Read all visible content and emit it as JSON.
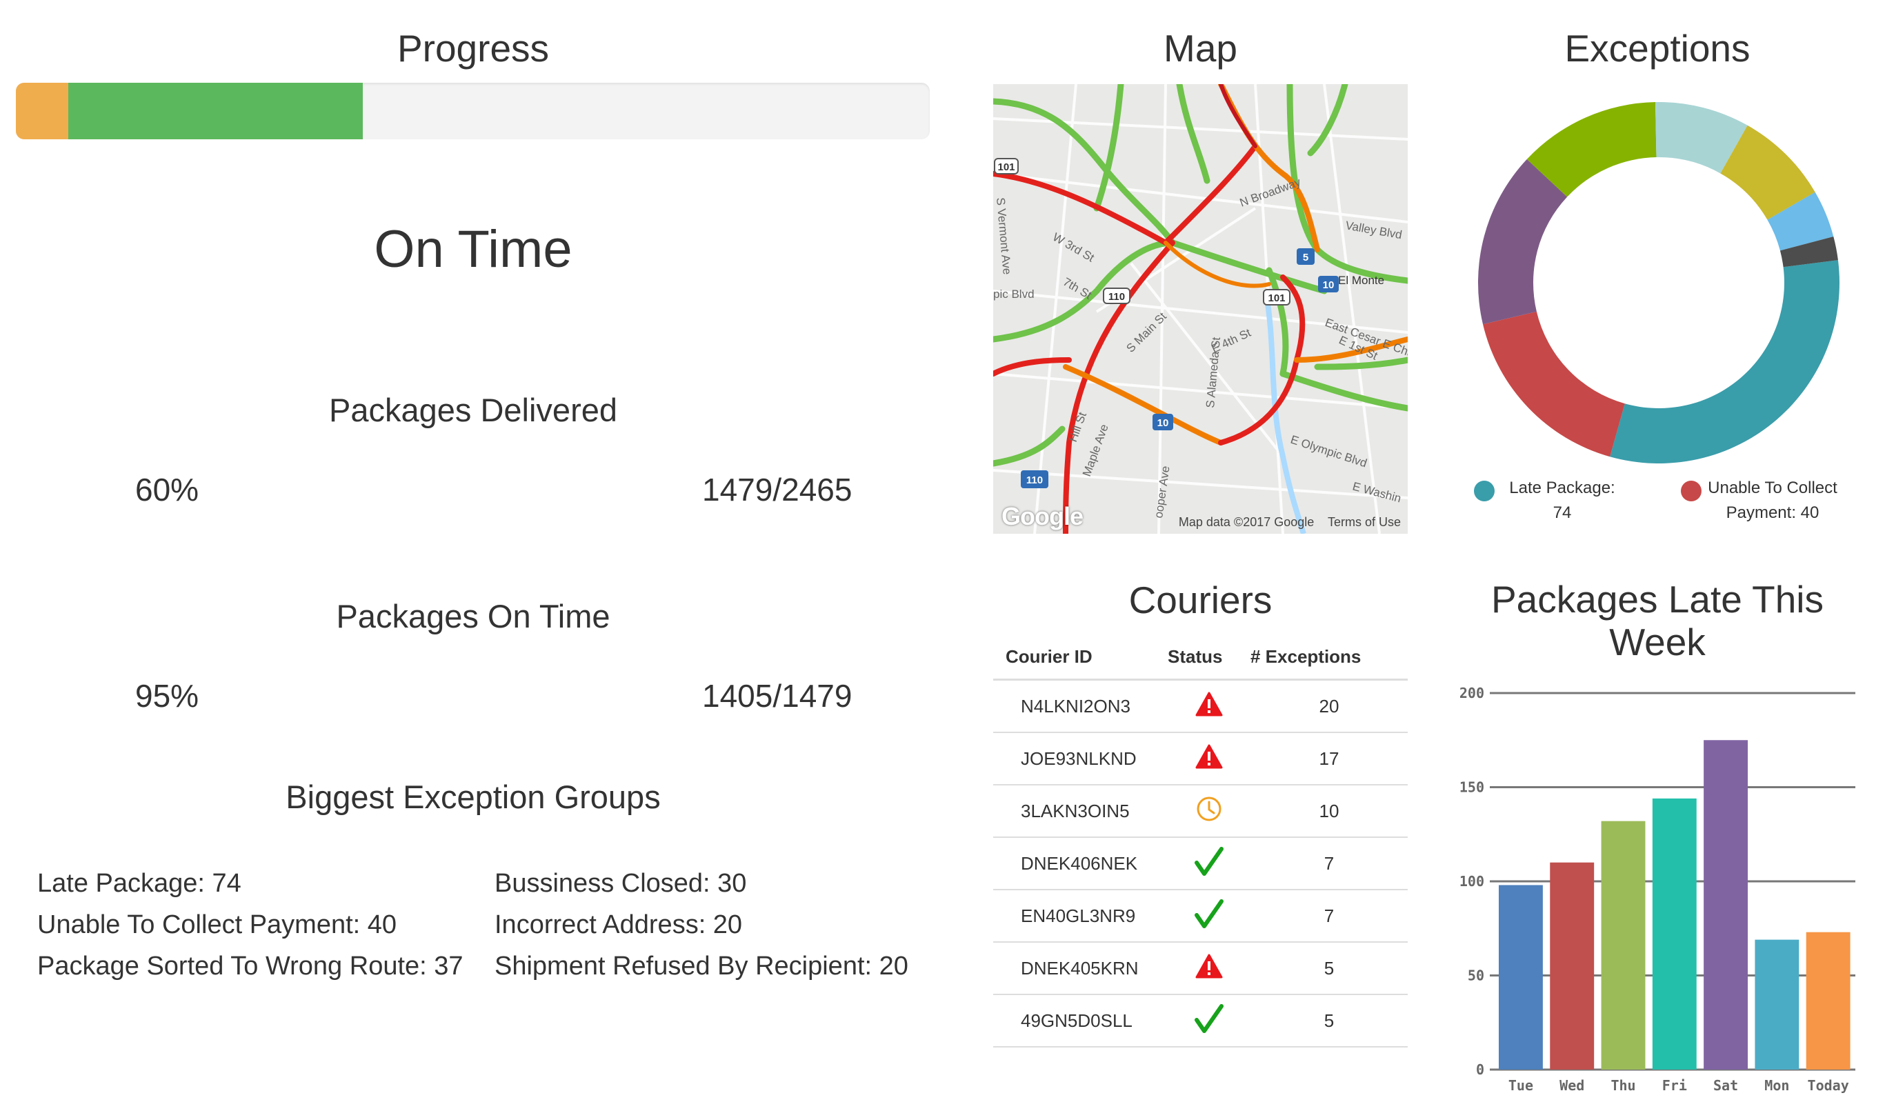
{
  "progress": {
    "title": "Progress",
    "segments": [
      {
        "name": "late",
        "color": "#f0ad4e",
        "percent": 5.7
      },
      {
        "name": "on-time",
        "color": "#5cb85c",
        "percent": 32.3
      }
    ],
    "status": "On Time"
  },
  "packages_delivered": {
    "title": "Packages Delivered",
    "percent": "60%",
    "count": "1479/2465"
  },
  "packages_on_time": {
    "title": "Packages On Time",
    "percent": "95%",
    "count": "1405/1479"
  },
  "exception_groups": {
    "title": "Biggest Exception Groups",
    "items": [
      "Late Package: 74",
      "Unable To Collect Payment: 40",
      "Package Sorted To Wrong Route: 37",
      "Bussiness Closed: 30",
      "Incorrect Address: 20",
      "Shipment Refused By Recipient: 20"
    ]
  },
  "map": {
    "title": "Map",
    "logo": "Google",
    "attribution": "Map data ©2017 Google",
    "terms": "Terms of Use",
    "labels": [
      "N Broadway",
      "Valley Blvd",
      "W 3rd St",
      "7th St",
      "S Main St",
      "E 4th St",
      "El Monte",
      "East Cesar E Cha",
      "E 1st St",
      "E Olympic Blvd",
      "E Washin",
      "Hill St",
      "Maple Ave",
      "S Alameda St",
      "ooper Ave",
      "pic Blvd",
      "S Vermont Ave"
    ],
    "shields": [
      "101",
      "110",
      "101",
      "5",
      "10",
      "10",
      "110"
    ]
  },
  "exceptions_chart": {
    "title": "Exceptions",
    "legend": [
      {
        "label": "Late Package:",
        "value": "74",
        "color": "#3a9daa"
      },
      {
        "label": "Unable To Collect Payment:",
        "value": "40",
        "color": "#c74848"
      }
    ]
  },
  "couriers": {
    "title": "Couriers",
    "headers": [
      "Courier ID",
      "Status",
      "# Exceptions"
    ],
    "rows": [
      {
        "id": "N4LKNI2ON3",
        "status": "alert",
        "exceptions": "20"
      },
      {
        "id": "JOE93NLKND",
        "status": "alert",
        "exceptions": "17"
      },
      {
        "id": "3LAKN3OIN5",
        "status": "clock",
        "exceptions": "10"
      },
      {
        "id": "DNEK406NEK",
        "status": "ok",
        "exceptions": "7"
      },
      {
        "id": "EN40GL3NR9",
        "status": "ok",
        "exceptions": "7"
      },
      {
        "id": "DNEK405KRN",
        "status": "alert",
        "exceptions": "5"
      },
      {
        "id": "49GN5D0SLL",
        "status": "ok",
        "exceptions": "5"
      }
    ]
  },
  "late_week": {
    "title_line1": "Packages Late This",
    "title_line2": "Week"
  },
  "chart_data": [
    {
      "type": "pie",
      "title": "Exceptions",
      "slices": [
        {
          "name": "Late Package",
          "value": 74,
          "color": "#3a9daa"
        },
        {
          "name": "Unable To Collect Payment",
          "value": 40,
          "color": "#c74848"
        },
        {
          "name": "",
          "value": 37,
          "color": "#7d5a86"
        },
        {
          "name": "",
          "value": 30,
          "color": "#86b300"
        },
        {
          "name": "",
          "value": 20,
          "color": "#a8d4d4"
        },
        {
          "name": "",
          "value": 20,
          "color": "#c9b92d"
        },
        {
          "name": "",
          "value": 10,
          "color": "#6cbbe8"
        },
        {
          "name": "",
          "value": 5,
          "color": "#4d4d4d"
        }
      ]
    },
    {
      "type": "bar",
      "title": "Packages Late This Week",
      "categories": [
        "Tue",
        "Wed",
        "Thu",
        "Fri",
        "Sat",
        "Mon",
        "Today"
      ],
      "values": [
        98,
        110,
        132,
        144,
        175,
        69,
        73
      ],
      "colors": [
        "#4e81bd",
        "#c0504d",
        "#9bbb59",
        "#23bfaa",
        "#8064a2",
        "#4bacc6",
        "#f79646"
      ],
      "yticks": [
        "0",
        "50",
        "100",
        "150",
        "200"
      ],
      "ylim": [
        0,
        200
      ],
      "xlabel": "",
      "ylabel": ""
    }
  ]
}
